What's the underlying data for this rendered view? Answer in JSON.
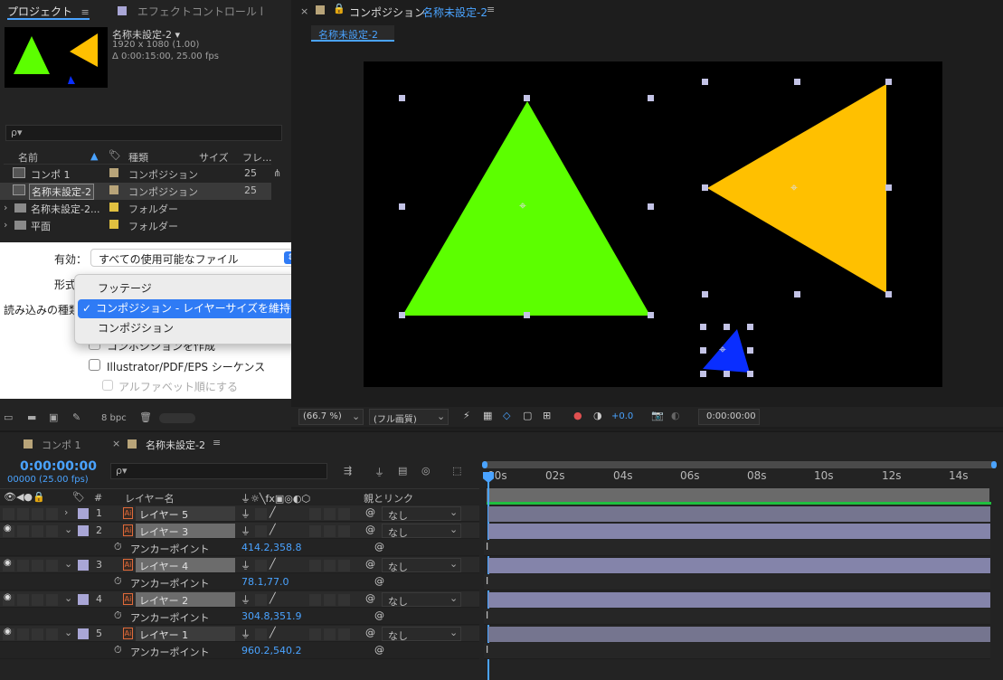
{
  "project_panel": {
    "tab_project": "プロジェクト",
    "tab_effects": "エフェクトコントロール l",
    "item_name": "名称未設定-2 ▾",
    "item_res": "1920 x 1080 (1.00)",
    "item_dur": "Δ 0:00:15:00, 25.00 fps",
    "search_placeholder": "ρ▾",
    "col_name": "名前",
    "col_type": "種類",
    "col_size": "サイズ",
    "col_frame": "フレ...",
    "rows": [
      {
        "name": "コンポ 1",
        "type": "コンポジション",
        "fps": "25",
        "color": "#b8a479"
      },
      {
        "name": "名称未設定-2",
        "type": "コンポジション",
        "fps": "25",
        "color": "#b8a479"
      },
      {
        "name": "名称未設定-2...",
        "type": "フォルダー",
        "fps": "",
        "color": "#e0c040"
      },
      {
        "name": "平面",
        "type": "フォルダー",
        "fps": "",
        "color": "#e0c040"
      }
    ],
    "bpc": "8 bpc"
  },
  "import_dialog": {
    "enable_label": "有効：",
    "enable_value": "すべての使用可能なファイル",
    "format_label": "形式",
    "import_as_label": "読み込みの種類",
    "menu": [
      "フッテージ",
      "コンポジション - レイヤーサイズを維持",
      "コンポジション"
    ],
    "check_create_comp": "コンポジションを作成",
    "check_illustrator": "Illustrator/PDF/EPS シーケンス",
    "check_alpha": "アルファベット順にする"
  },
  "comp_viewer": {
    "tab_prefix": "コンポジション",
    "tab_name": "名称未設定-2",
    "subtab": "名称未設定-2",
    "zoom": "(66.7 %)",
    "quality": "(フル画質)",
    "exposure": "+0.0",
    "timecode": "0:00:00:00"
  },
  "timeline": {
    "tab1": "コンポ 1",
    "tab2": "名称未設定-2",
    "timecode": "0:00:00:00",
    "frames": "00000 (25.00 fps)",
    "col_layer": "レイヤー名",
    "col_parent": "親とリンク",
    "ticks": [
      ":00s",
      "02s",
      "04s",
      "06s",
      "08s",
      "10s",
      "12s",
      "14s"
    ],
    "layers": [
      {
        "num": "1",
        "name": "レイヤー 5",
        "parent": "なし",
        "anchor": null
      },
      {
        "num": "2",
        "name": "レイヤー 3",
        "parent": "なし",
        "anchor": "414.2,358.8"
      },
      {
        "num": "3",
        "name": "レイヤー 4",
        "parent": "なし",
        "anchor": "78.1,77.0"
      },
      {
        "num": "4",
        "name": "レイヤー 2",
        "parent": "なし",
        "anchor": "304.8,351.9"
      },
      {
        "num": "5",
        "name": "レイヤー 1",
        "parent": "なし",
        "anchor": "960.2,540.2"
      }
    ],
    "anchor_label": "アンカーポイント"
  },
  "colors": {
    "green": "#5cff00",
    "orange": "#ffc000",
    "blue": "#0a2eff",
    "accent": "#4aa3ff"
  }
}
